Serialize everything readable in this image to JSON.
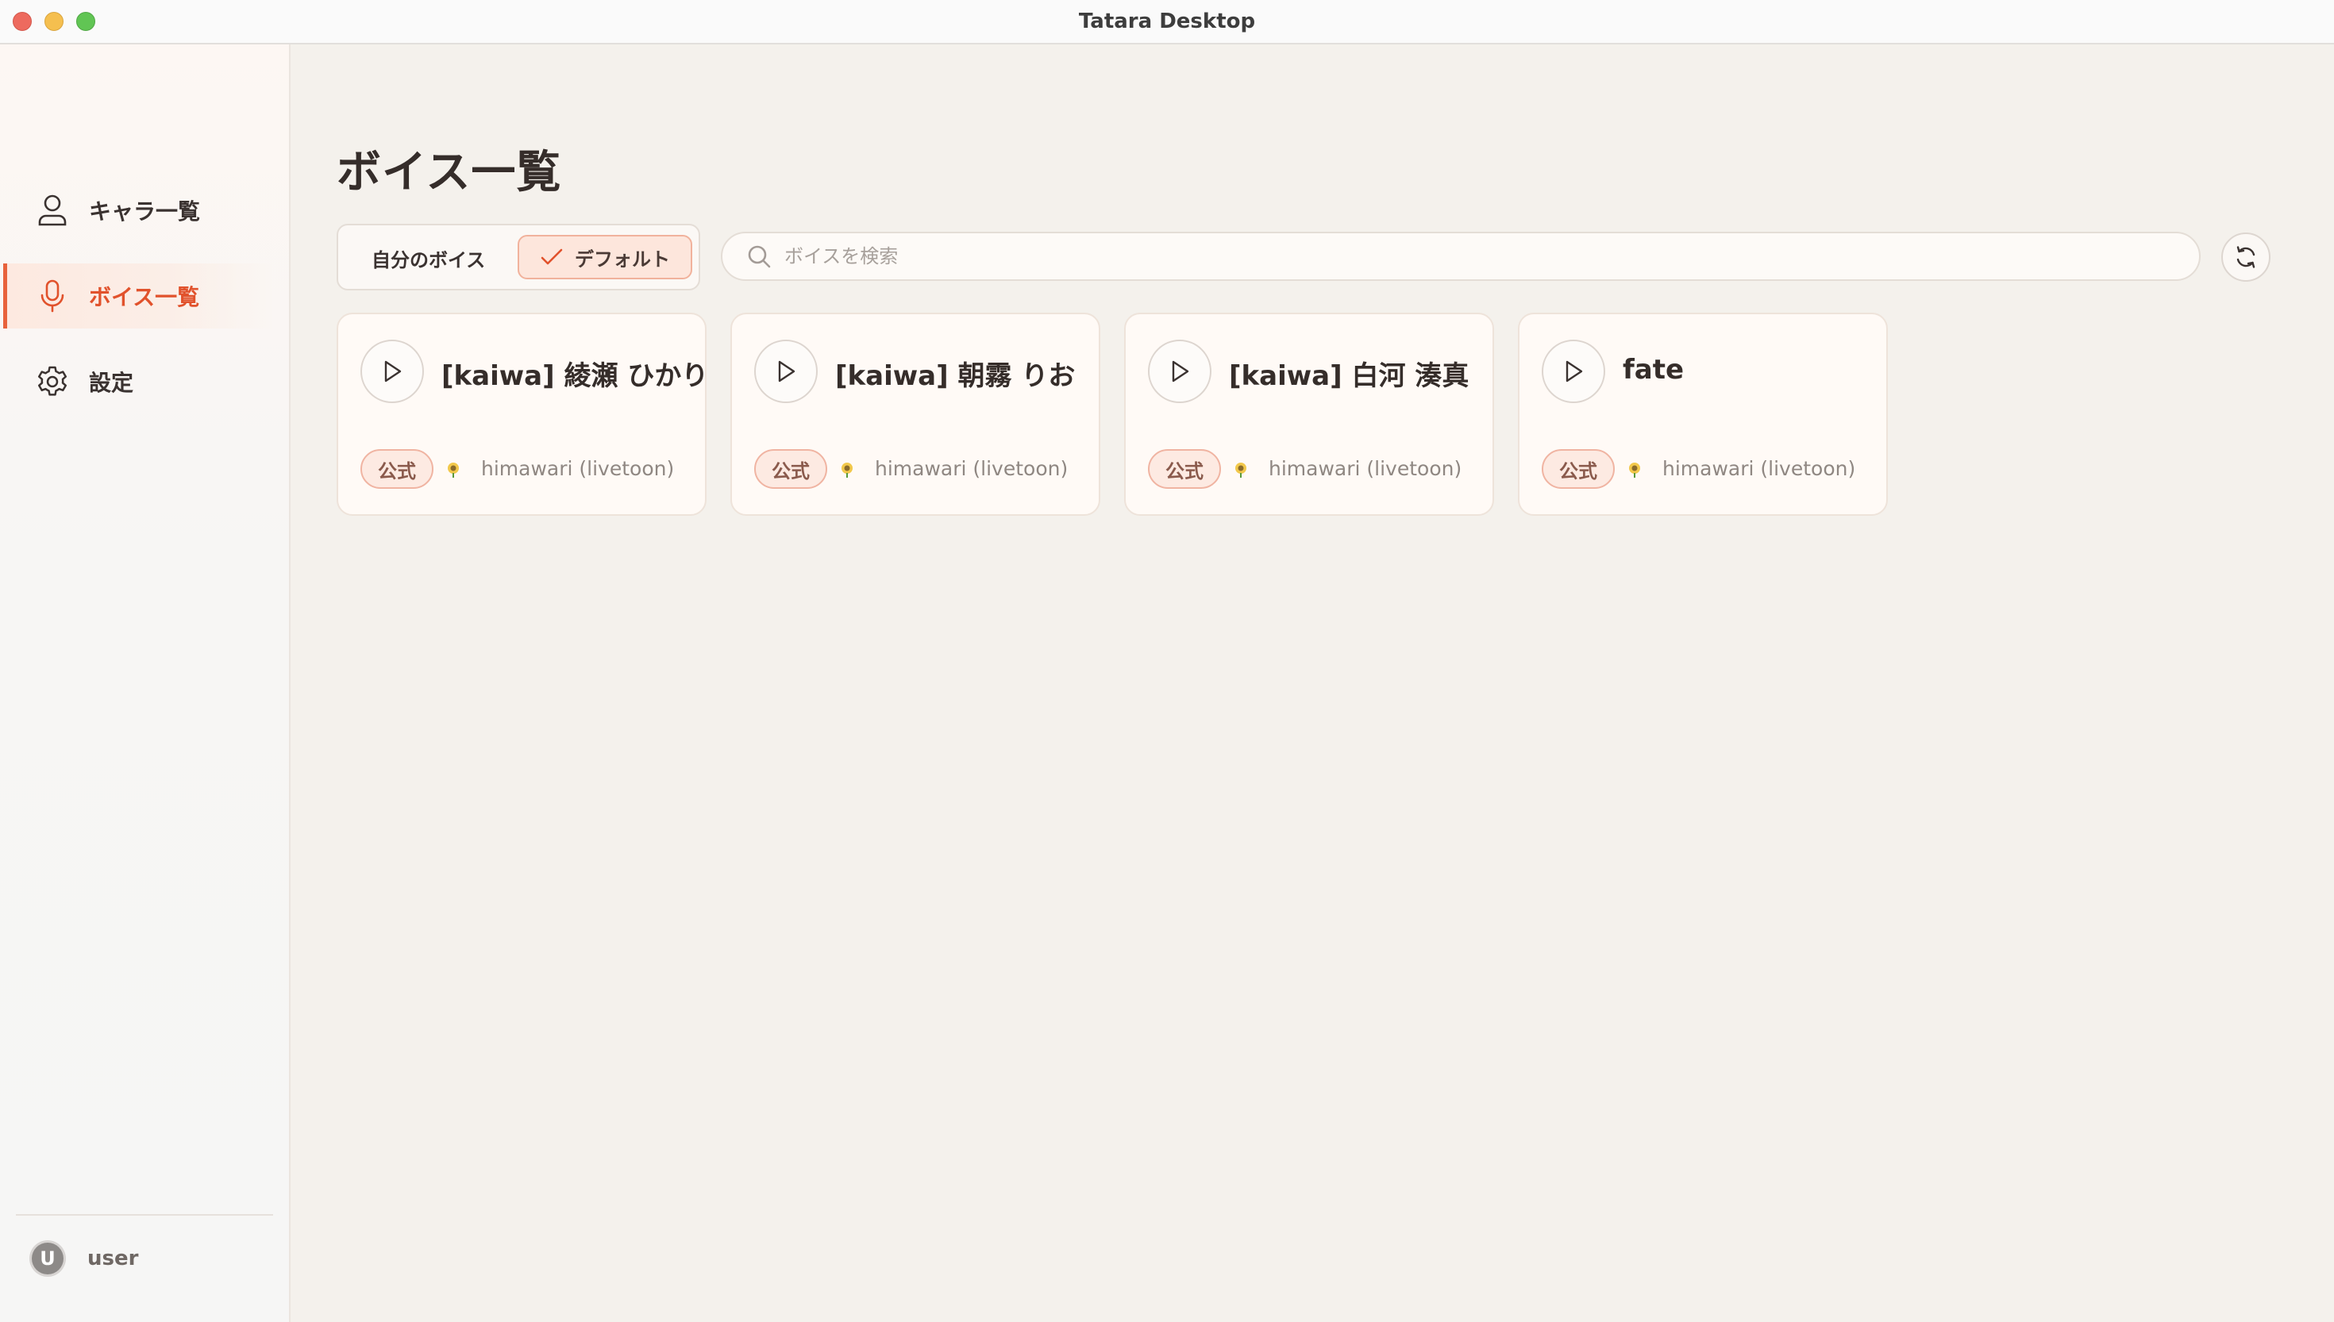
{
  "window": {
    "title": "Tatara Desktop"
  },
  "sidebar": {
    "items": [
      {
        "label": "キャラ一覧",
        "icon": "user-icon",
        "active": false
      },
      {
        "label": "ボイス一覧",
        "icon": "microphone-icon",
        "active": true
      },
      {
        "label": "設定",
        "icon": "gear-icon",
        "active": false
      }
    ],
    "user": {
      "avatar_letter": "U",
      "name": "user"
    }
  },
  "main": {
    "title": "ボイス一覧",
    "filters": {
      "mine_label": "自分のボイス",
      "default_label": "デフォルト",
      "selected": "default"
    },
    "search": {
      "placeholder": "ボイスを検索",
      "value": ""
    },
    "refresh_icon": "refresh-icon",
    "cards": [
      {
        "name": "[kaiwa] 綾瀬 ひかり",
        "badge": "公式",
        "model_icon": "sunflower-icon",
        "model": "himawari (livetoon)"
      },
      {
        "name": "[kaiwa] 朝霧 りお",
        "badge": "公式",
        "model_icon": "sunflower-icon",
        "model": "himawari (livetoon)"
      },
      {
        "name": "[kaiwa] 白河 湊真",
        "badge": "公式",
        "model_icon": "sunflower-icon",
        "model": "himawari (livetoon)"
      },
      {
        "name": "fate",
        "badge": "公式",
        "model_icon": "sunflower-icon",
        "model": "himawari (livetoon)"
      }
    ]
  },
  "colors": {
    "accent": "#e1522c",
    "background": "#f4f1ec",
    "card": "#fffaf6",
    "badge_border": "#f0b4a2"
  }
}
